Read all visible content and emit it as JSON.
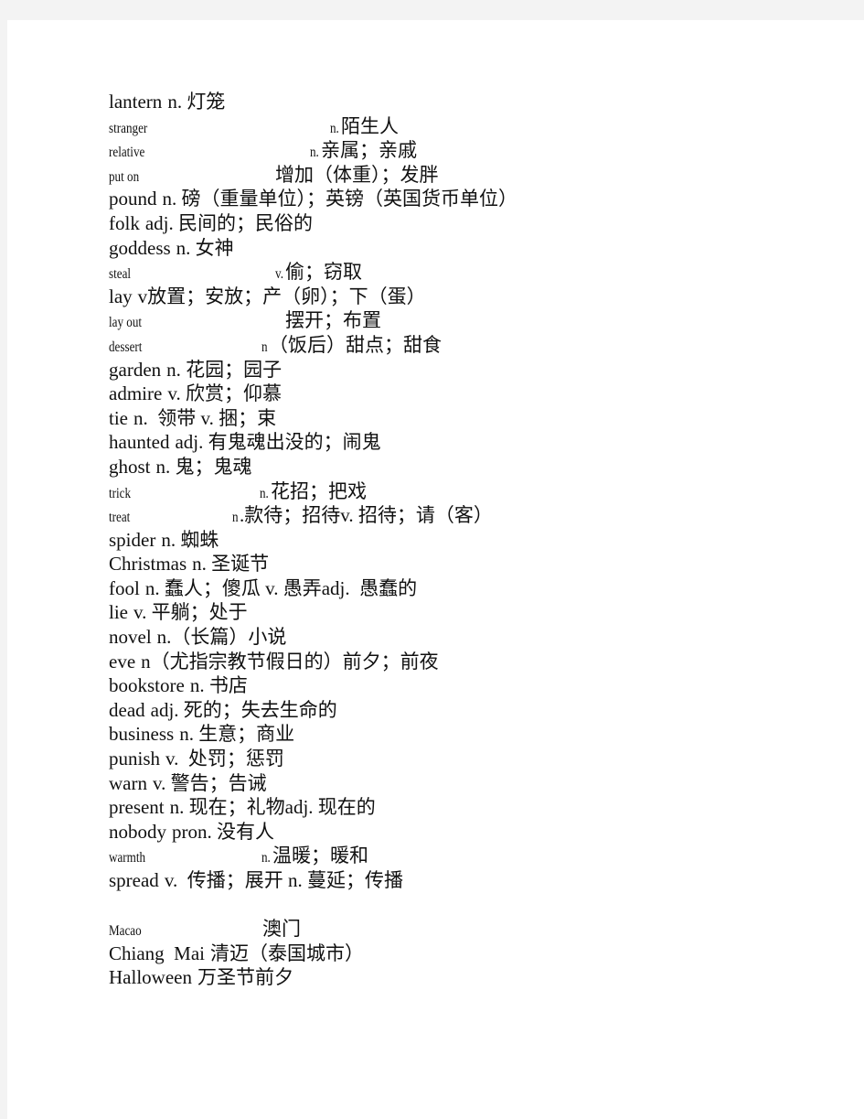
{
  "document": {
    "entries": [
      {
        "word": "lantern",
        "def": "n. 灯笼"
      },
      {
        "word": "stranger",
        "def": "陌生人",
        "pos": "n."
      },
      {
        "word": "relative",
        "def": "亲属；亲戚",
        "pos": "n."
      },
      {
        "word": "put on",
        "def": "增加（体重）；发胖",
        "pos": ""
      },
      {
        "word": "pound",
        "def": "n. 磅（重量单位）；英镑（英国货币单位）"
      },
      {
        "word": "folk",
        "def": "adj. 民间的；民俗的"
      },
      {
        "word": "goddess",
        "def": "n. 女神"
      },
      {
        "word": "steal",
        "def": "偷；窃取",
        "pos": "v."
      },
      {
        "word": "lay",
        "def": "v放置；安放；产（卵）；下（蛋）"
      },
      {
        "word": "lay out",
        "def": "摆开；布置",
        "pos": ""
      },
      {
        "word": "dessert",
        "def": "（饭后）甜点；甜食",
        "pos": "n"
      },
      {
        "word": "garden",
        "def": "n. 花园；园子"
      },
      {
        "word": "admire",
        "def": "v. 欣赏；仰慕"
      },
      {
        "word": "tie",
        "def": "n.  领带 v. 捆；束"
      },
      {
        "word": "haunted",
        "def": "adj. 有鬼魂出没的；闹鬼"
      },
      {
        "word": "ghost",
        "def": "n. 鬼；鬼魂"
      },
      {
        "word": "trick",
        "def": "花招；把戏",
        "pos": "n."
      },
      {
        "word": "treat",
        "def": ".款待；招待v. 招待；请（客）",
        "pos": "n"
      },
      {
        "word": "spider",
        "def": "n. 蜘蛛"
      },
      {
        "word": "Christmas",
        "def": "n. 圣诞节"
      },
      {
        "word": "fool",
        "def": "n. 蠢人；傻瓜 v. 愚弄adj.  愚蠢的"
      },
      {
        "word": "lie",
        "def": "v. 平躺；处于"
      },
      {
        "word": "novel",
        "def": "n.（长篇）小说"
      },
      {
        "word": "eve",
        "def": "n（尤指宗教节假日的）前夕；前夜"
      },
      {
        "word": "bookstore",
        "def": "n. 书店"
      },
      {
        "word": "dead",
        "def": "adj. 死的；失去生命的"
      },
      {
        "word": "business",
        "def": "n. 生意；商业"
      },
      {
        "word": "punish",
        "def": "v.  处罚；惩罚"
      },
      {
        "word": "warn",
        "def": "v. 警告；告诫"
      },
      {
        "word": "present",
        "def": "n. 现在；礼物adj. 现在的"
      },
      {
        "word": "nobody",
        "def": "pron. 没有人"
      },
      {
        "word": "warmth",
        "def": "温暖；暖和",
        "pos": "n."
      },
      {
        "word": "spread",
        "def": "v.  传播；展开 n. 蔓延；传播"
      }
    ],
    "proper_nouns": [
      {
        "word": "Macao",
        "def": "澳门"
      },
      {
        "word": "Chiang  Mai",
        "def": "清迈（泰国城市）"
      },
      {
        "word": "Halloween",
        "def": "万圣节前夕"
      }
    ]
  }
}
